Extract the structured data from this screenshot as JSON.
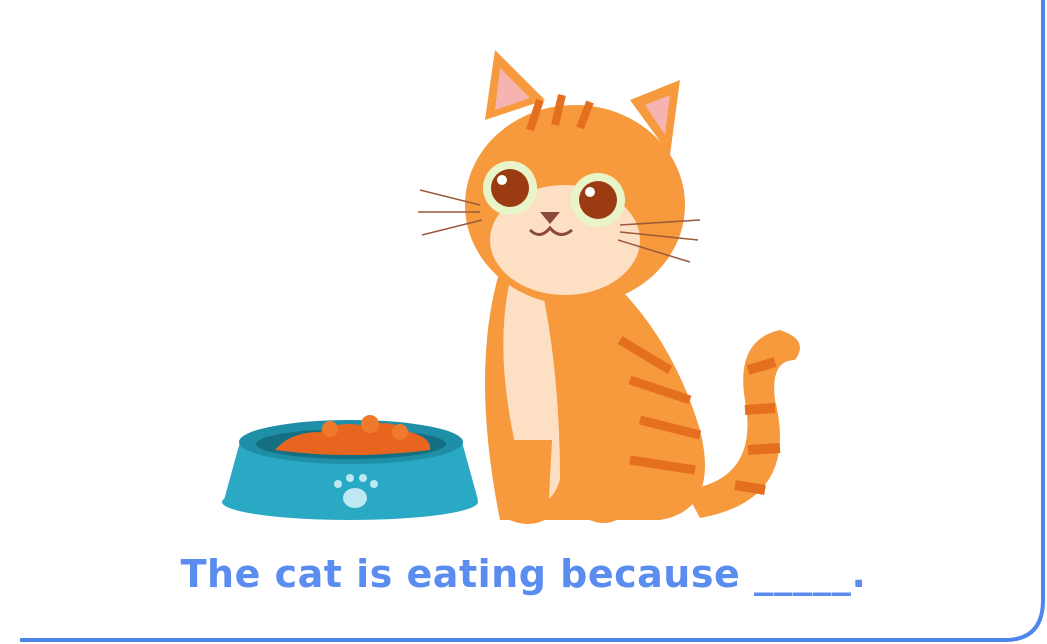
{
  "card": {
    "sentence": "The cat is eating because _____.",
    "border_color": "#4f86ee",
    "text_color": "#5b8cf0"
  },
  "illustration": {
    "subject": "cat-icon",
    "object": "food-bowl-icon",
    "decoration": "paw-print-icon",
    "colors": {
      "cat_fur": "#f7993d",
      "cat_stripes": "#e46f1f",
      "cat_belly": "#fde0c4",
      "bowl": "#2aa9c4",
      "food": "#e8651f"
    }
  }
}
